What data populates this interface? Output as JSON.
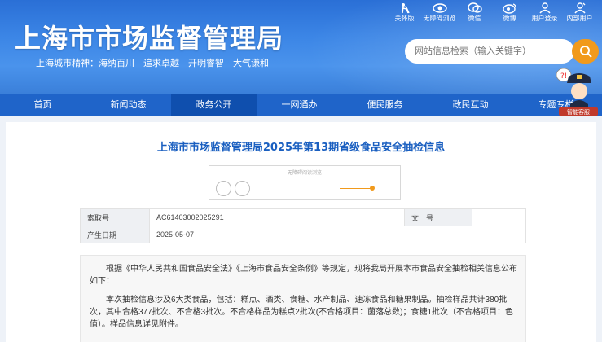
{
  "header": {
    "title": "上海市市场监督管理局",
    "slogan": "上海城市精神：海纳百川　追求卓越　开明睿智　大气谦和",
    "toplinks": [
      {
        "label": "关怀版",
        "icon": "elder-care-icon"
      },
      {
        "label": "无障碍浏览",
        "icon": "accessibility-eye-icon"
      },
      {
        "label": "微信",
        "icon": "wechat-icon"
      },
      {
        "label": "微博",
        "icon": "weibo-icon"
      },
      {
        "label": "用户登录",
        "icon": "user-icon"
      },
      {
        "label": "内部用户",
        "icon": "internal-user-icon"
      }
    ],
    "search_placeholder": "网站信息检索（输入关键字）",
    "robot_label": "智能客服"
  },
  "nav": {
    "items": [
      "首页",
      "新闻动态",
      "政务公开",
      "一网通办",
      "便民服务",
      "政民互动",
      "专题专栏"
    ],
    "active_index": 2
  },
  "article": {
    "title": "上海市市场监督管理局2025年第13期省级食品安全抽检信息",
    "tool_tip": "无障碍阅读浏览",
    "meta": {
      "index_label": "索取号",
      "index_value": "AC61403002025291",
      "doc_label": "文　号",
      "doc_value": "",
      "date_label": "产生日期",
      "date_value": "2025-05-07"
    },
    "paragraph1": "根据《中华人民共和国食品安全法》《上海市食品安全条例》等规定，现将我局开展本市食品安全抽检相关信息公布如下：",
    "paragraph2": "本次抽检信息涉及6大类食品，包括：糕点、酒类、食糖、水产制品、速冻食品和糖果制品。抽检样品共计380批次，其中合格377批次、不合格3批次。不合格样品为糕点2批次(不合格项目：菌落总数)；食糖1批次（不合格项目：色值）。样品信息详见附件。"
  },
  "colors": {
    "header_blue": "#3c86e6",
    "nav_blue": "#1f64c9",
    "nav_active": "#0f4fae",
    "accent_orange": "#f19a1c",
    "title_blue": "#1a5fc0"
  }
}
